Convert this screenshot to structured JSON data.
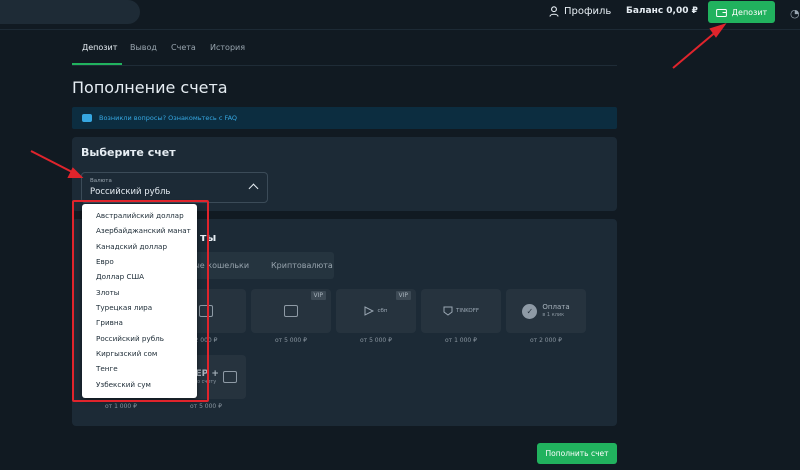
{
  "header": {
    "profile_label": "Профиль",
    "balance_label": "Баланс 0,00 ₽",
    "deposit_button": "Депозит"
  },
  "tabs": [
    {
      "label": "Депозит",
      "active": true
    },
    {
      "label": "Вывод",
      "active": false
    },
    {
      "label": "Счета",
      "active": false
    },
    {
      "label": "История",
      "active": false
    }
  ],
  "page_title": "Пополнение счета",
  "faq_text": "Возникли вопросы? Ознакомьтесь с FAQ",
  "account_section": {
    "title": "Выберите счет",
    "select_label": "Валюта",
    "select_value": "Российский рубль"
  },
  "dropdown_options": [
    "Австралийский доллар",
    "Азербайджанский манат",
    "Канадский доллар",
    "Евро",
    "Доллар США",
    "Злоты",
    "Турецкая лира",
    "Гривна",
    "Российский рубль",
    "Киргызский сом",
    "Тенге",
    "Узбекский сум"
  ],
  "methods_section": {
    "title_fragment": "ты",
    "method_tabs": [
      "нные кошельки",
      "Криптовалюта"
    ],
    "cards_row1": [
      {
        "label": "",
        "vip": "",
        "price": "2 000 ₽"
      },
      {
        "label": "",
        "vip": "VIP",
        "price": "от 5 000 ₽"
      },
      {
        "label": "сбп",
        "vip": "VIP",
        "price": "от 5 000 ₽"
      },
      {
        "label": "TINKOFF",
        "vip": "",
        "price": "от 1 000 ₽"
      },
      {
        "label": "Оплата",
        "sub": "в 1 клик",
        "vip": "",
        "price": "от 2 000 ₽"
      }
    ],
    "cards_row2": [
      {
        "label": "",
        "price": "от 1 000 ₽"
      },
      {
        "label": "SEP +",
        "sub": "а по счету",
        "price": "от 5 000 ₽"
      }
    ]
  },
  "submit_button": "Пополнить счет",
  "colors": {
    "accent": "#21b25e",
    "highlight": "#e0242c",
    "faq_bg": "#0c2d40"
  }
}
